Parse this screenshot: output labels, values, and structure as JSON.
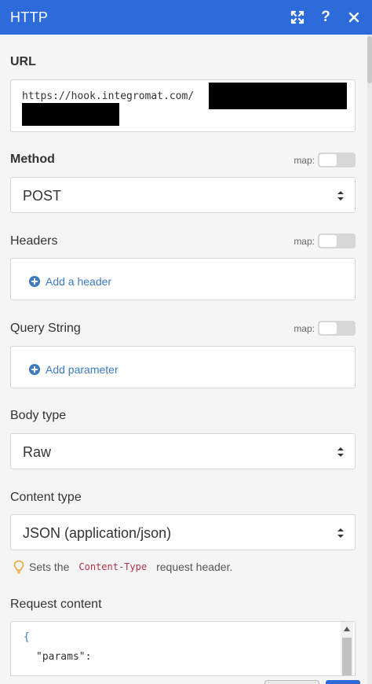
{
  "window": {
    "title": "HTTP"
  },
  "url": {
    "label": "URL",
    "value": "https://hook.integromat.com/"
  },
  "method": {
    "label": "Method",
    "map_label": "map:",
    "selected": "POST"
  },
  "headers": {
    "label": "Headers",
    "map_label": "map:",
    "add_label": "Add a header"
  },
  "query_string": {
    "label": "Query String",
    "map_label": "map:",
    "add_label": "Add parameter"
  },
  "body_type": {
    "label": "Body type",
    "selected": "Raw"
  },
  "content_type": {
    "label": "Content type",
    "selected": "JSON (application/json)",
    "hint_prefix": "Sets the",
    "hint_code": "Content-Type",
    "hint_suffix": "request header."
  },
  "request_content": {
    "label": "Request content",
    "line1": "{",
    "line2": "\"params\":"
  },
  "icons": {
    "expand": "expand-icon",
    "help": "help-icon",
    "close": "close-icon",
    "hint": "lightbulb-icon",
    "add": "plus-circle-icon",
    "select": "sort-arrows-icon"
  },
  "colors": {
    "titlebar": "#2d6bdb",
    "link": "#3b7bbf",
    "code": "#b5304a"
  }
}
